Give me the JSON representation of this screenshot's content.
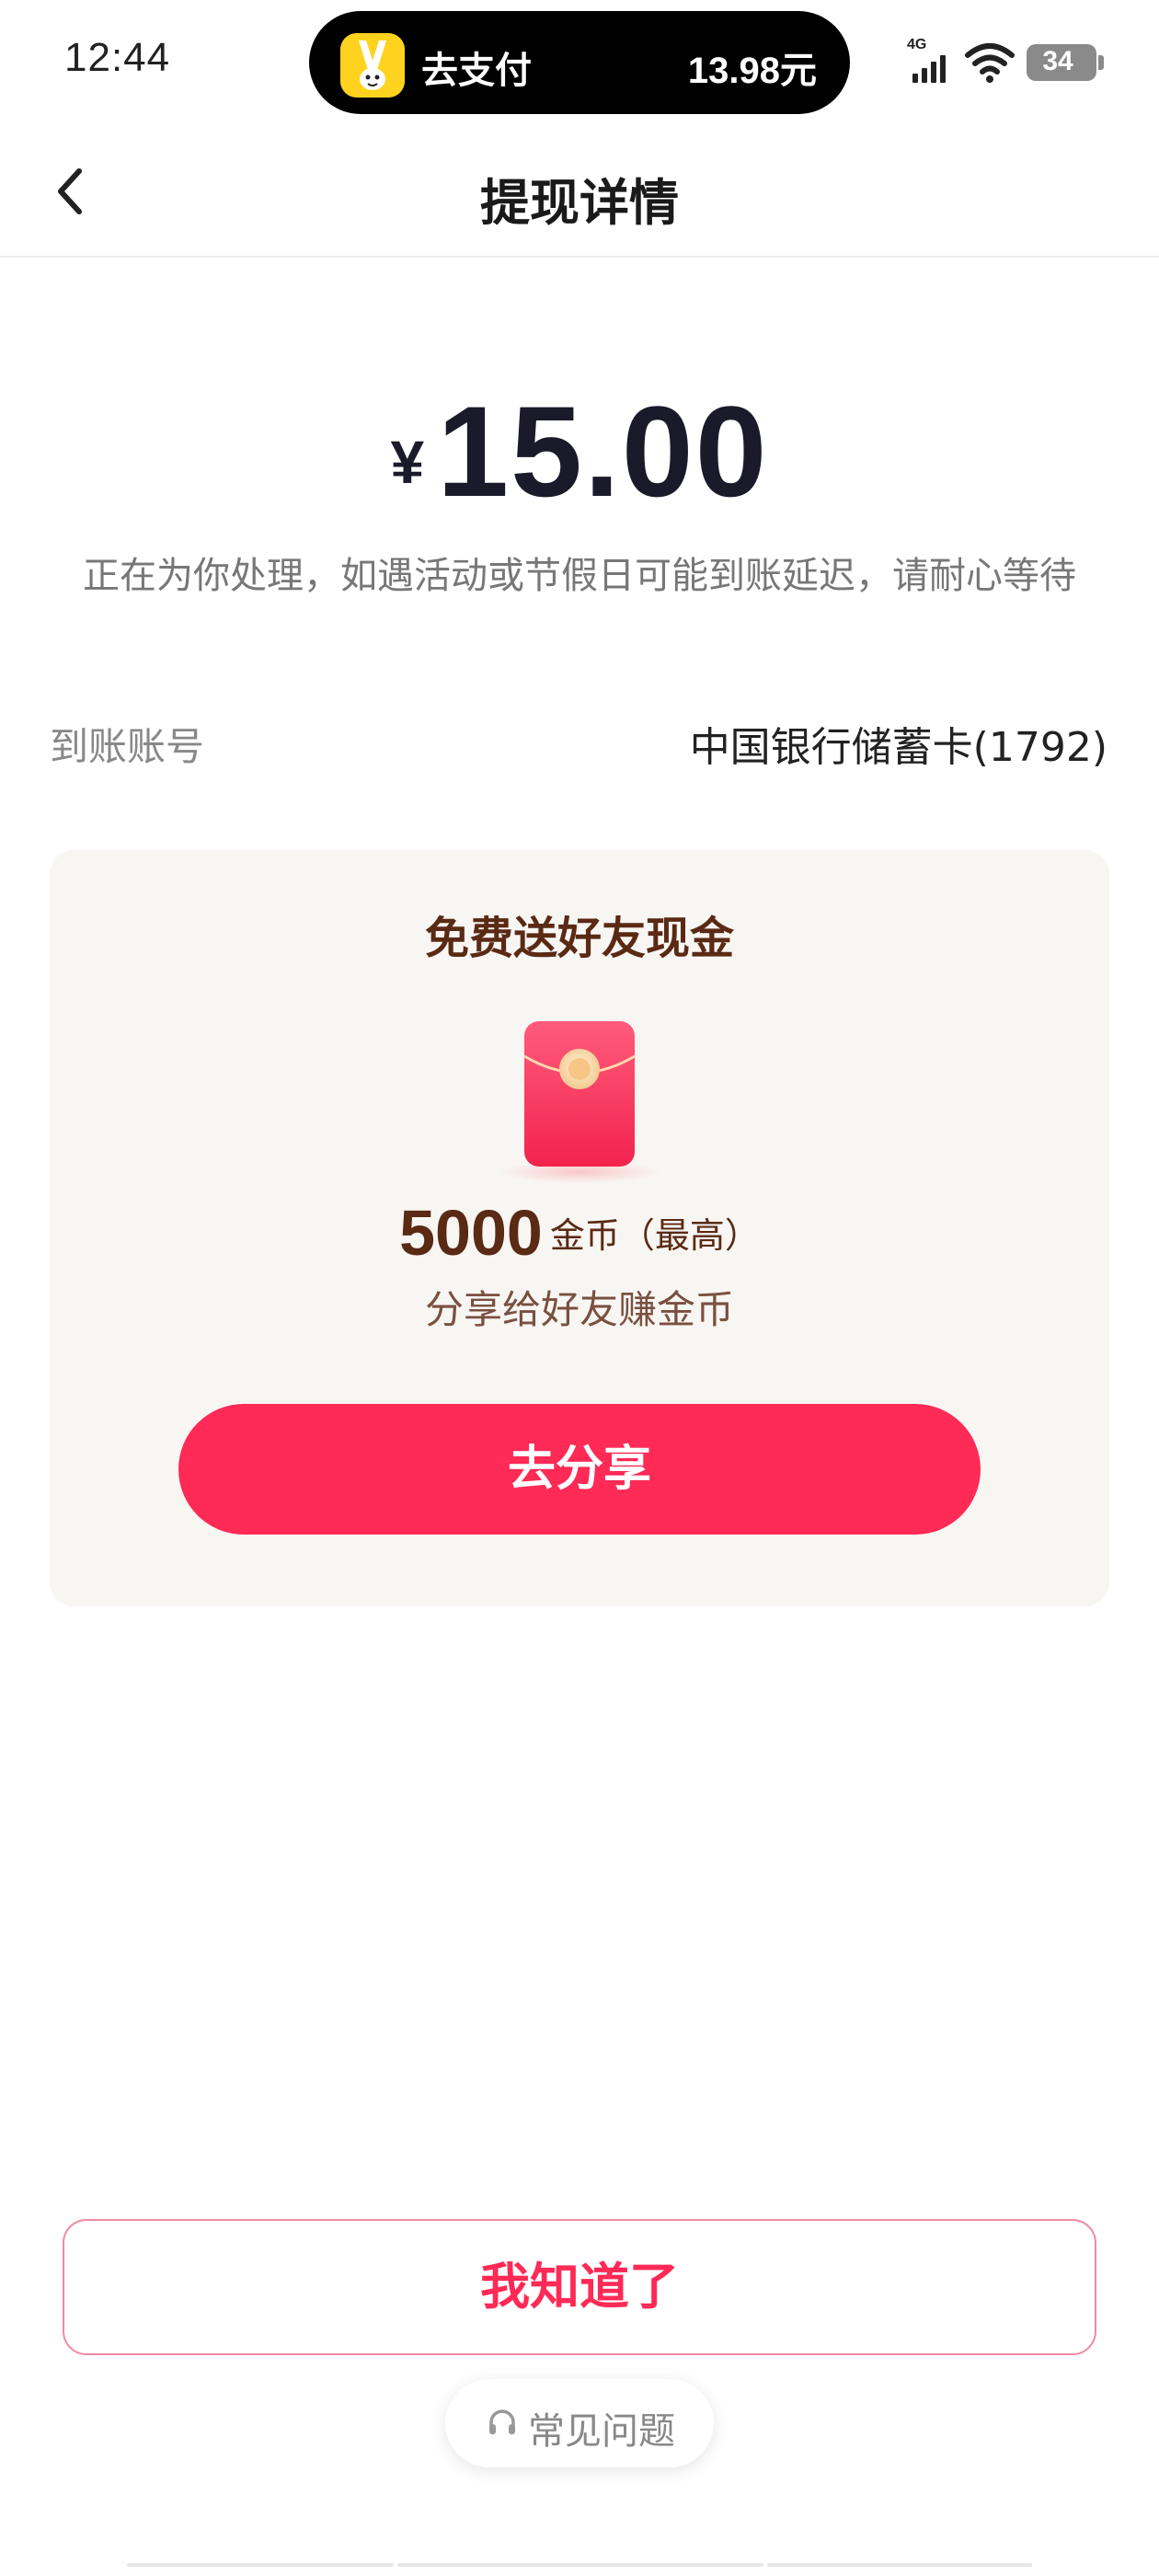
{
  "status_bar": {
    "time": "12:44",
    "network": "4G",
    "battery": "34",
    "live_activity": {
      "label": "去支付",
      "amount": "13.98元"
    }
  },
  "nav": {
    "title": "提现详情"
  },
  "withdrawal": {
    "currency_symbol": "¥",
    "amount": "15.00",
    "note": "正在为你处理，如遇活动或节假日可能到账延迟，请耐心等待",
    "account_label": "到账账号",
    "account_value": "中国银行储蓄卡(1792)"
  },
  "promo": {
    "title": "免费送好友现金",
    "coin_amount": "5000",
    "coin_unit": "金币（最高）",
    "subtitle": "分享给好友赚金币",
    "share_button": "去分享"
  },
  "footer": {
    "confirm_button": "我知道了",
    "faq_label": "常见问题"
  },
  "colors": {
    "accent": "#ff2a56",
    "promo_text": "#5a2a14",
    "card_bg": "#f8f6f3"
  }
}
